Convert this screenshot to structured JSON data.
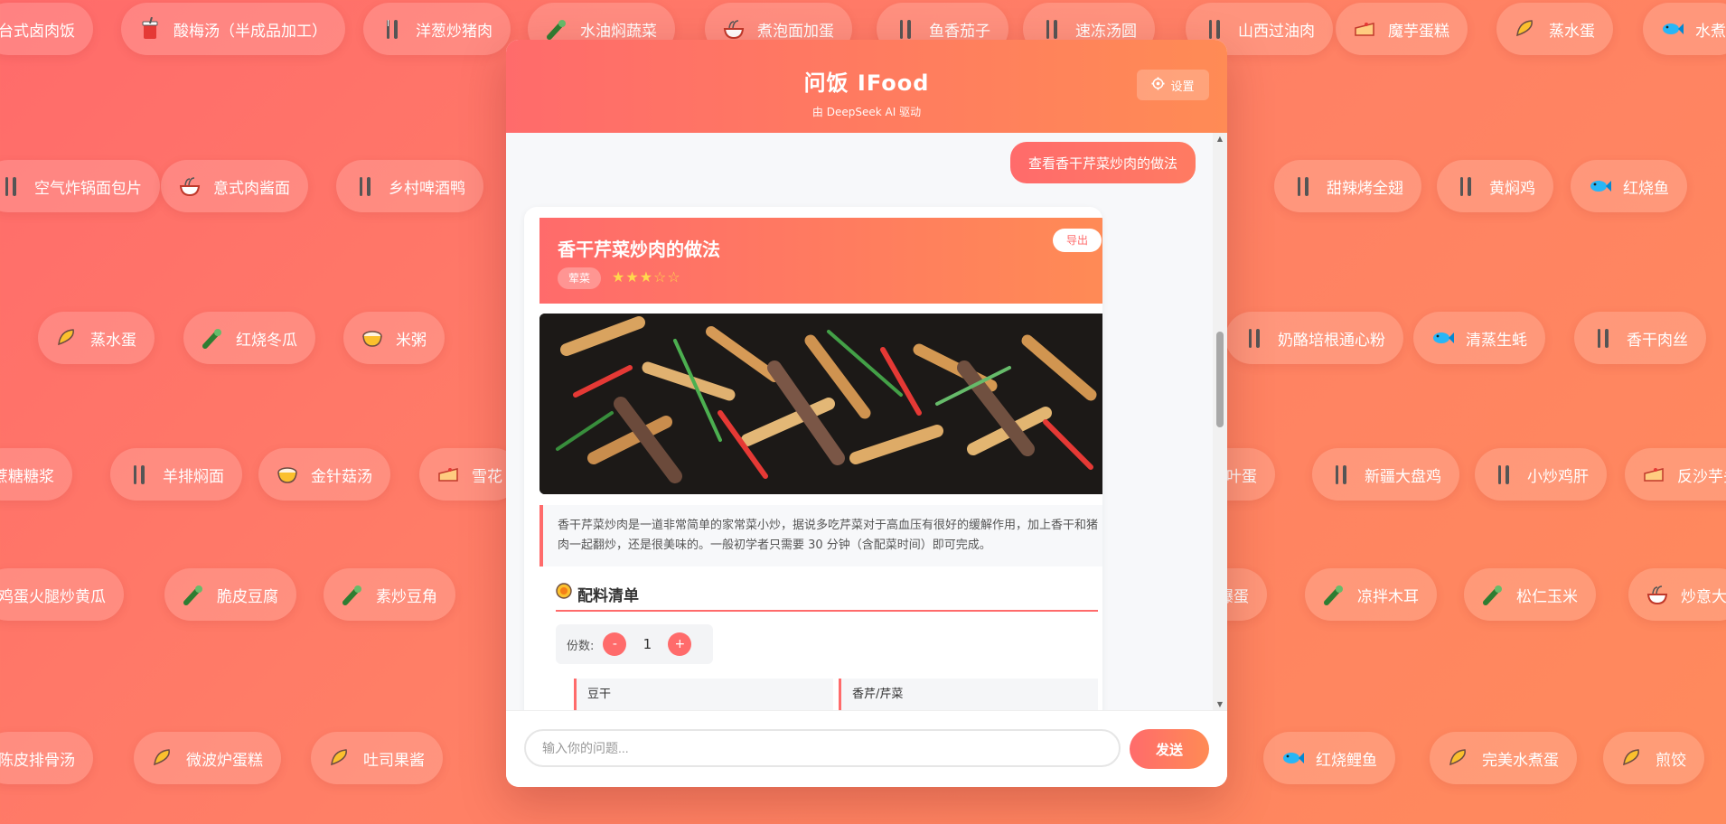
{
  "background_chips": [
    {
      "label": "台式卤肉饭",
      "icon": "fork-knife-icon"
    },
    {
      "label": "酸梅汤（半成品加工）",
      "icon": "drink-cup-icon"
    },
    {
      "label": "洋葱炒猪肉",
      "icon": "fork-knife-icon"
    },
    {
      "label": "水油焖蔬菜",
      "icon": "vegetable-icon"
    },
    {
      "label": "煮泡面加蛋",
      "icon": "noodle-bowl-icon"
    },
    {
      "label": "鱼香茄子",
      "icon": "fork-knife-icon"
    },
    {
      "label": "速冻汤圆",
      "icon": "fork-knife-icon"
    },
    {
      "label": "山西过油肉",
      "icon": "fork-knife-icon"
    },
    {
      "label": "魔芋蛋糕",
      "icon": "cake-icon"
    },
    {
      "label": "蒸水蛋",
      "icon": "taco-icon"
    },
    {
      "label": "水煮",
      "icon": "fish-icon"
    },
    {
      "label": "空气炸锅面包片",
      "icon": "fork-knife-icon"
    },
    {
      "label": "意式肉酱面",
      "icon": "noodle-bowl-icon"
    },
    {
      "label": "乡村啤酒鸭",
      "icon": "fork-knife-icon"
    },
    {
      "label": "甜辣烤全翅",
      "icon": "fork-knife-icon"
    },
    {
      "label": "黄焖鸡",
      "icon": "fork-knife-icon"
    },
    {
      "label": "红烧鱼",
      "icon": "fish-icon"
    },
    {
      "label": "蒸水蛋",
      "icon": "taco-icon"
    },
    {
      "label": "红烧冬瓜",
      "icon": "vegetable-icon"
    },
    {
      "label": "米粥",
      "icon": "rice-bowl-icon"
    },
    {
      "label": "奶酪培根通心粉",
      "icon": "fork-knife-icon"
    },
    {
      "label": "清蒸生蚝",
      "icon": "fish-icon"
    },
    {
      "label": "香干肉丝",
      "icon": "fork-knife-icon"
    },
    {
      "label": "蔗糖糖浆",
      "icon": "fork-knife-icon"
    },
    {
      "label": "羊排焖面",
      "icon": "fork-knife-icon"
    },
    {
      "label": "金针菇汤",
      "icon": "rice-bowl-icon"
    },
    {
      "label": "雪花",
      "icon": "cake-icon"
    },
    {
      "label": "茶叶蛋",
      "icon": "fork-knife-icon"
    },
    {
      "label": "新疆大盘鸡",
      "icon": "fork-knife-icon"
    },
    {
      "label": "小炒鸡肝",
      "icon": "fork-knife-icon"
    },
    {
      "label": "反沙芋头",
      "icon": "cake-icon"
    },
    {
      "label": "鸡蛋火腿炒黄瓜",
      "icon": "fork-knife-icon"
    },
    {
      "label": "脆皮豆腐",
      "icon": "vegetable-icon"
    },
    {
      "label": "素炒豆角",
      "icon": "vegetable-icon"
    },
    {
      "label": "爆蛋",
      "icon": "fork-knife-icon"
    },
    {
      "label": "凉拌木耳",
      "icon": "vegetable-icon"
    },
    {
      "label": "松仁玉米",
      "icon": "vegetable-icon"
    },
    {
      "label": "炒意大",
      "icon": "noodle-bowl-icon"
    },
    {
      "label": "陈皮排骨汤",
      "icon": "fork-knife-icon"
    },
    {
      "label": "微波炉蛋糕",
      "icon": "taco-icon"
    },
    {
      "label": "吐司果酱",
      "icon": "taco-icon"
    },
    {
      "label": "红烧鲤鱼",
      "icon": "fish-icon"
    },
    {
      "label": "完美水煮蛋",
      "icon": "taco-icon"
    },
    {
      "label": "煎饺",
      "icon": "taco-icon"
    }
  ],
  "header": {
    "title": "问饭 IFood",
    "subtitle": "由 DeepSeek AI 驱动",
    "settings_label": "设置"
  },
  "chat": {
    "user_message": "查看香干芹菜炒肉的做法"
  },
  "recipe": {
    "title": "香干芹菜炒肉的做法",
    "tag": "荤菜",
    "difficulty_stars": "★★★☆☆",
    "export_label": "导出",
    "description": "香干芹菜炒肉是一道非常简单的家常菜小炒，据说多吃芹菜对于高血压有很好的缓解作用，加上香干和猪肉一起翻炒，还是很美味的。一般初学者只需要 30 分钟（含配菜时间）即可完成。",
    "ingredients_title": "配料清单",
    "servings_label": "份数:",
    "servings_value": "1",
    "minus_label": "-",
    "plus_label": "+",
    "ingredients": [
      "豆干",
      "香芹/芹菜"
    ]
  },
  "input": {
    "placeholder": "输入你的问题...",
    "send_label": "发送"
  },
  "colors": {
    "accent": "#ff6b6b",
    "accent_end": "#ff8b55",
    "star": "#ffd84d"
  }
}
